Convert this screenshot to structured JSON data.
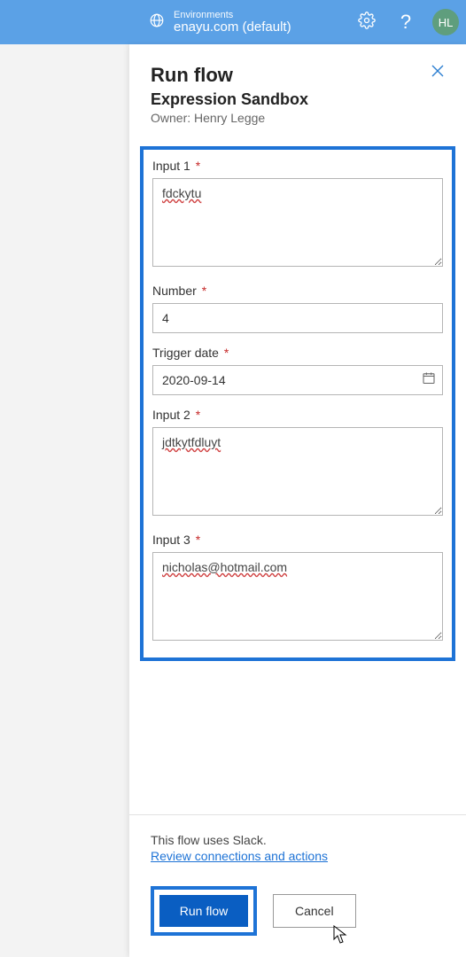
{
  "topbar": {
    "env_label": "Environments",
    "env_name": "enayu.com (default)",
    "avatar_initials": "HL"
  },
  "panel": {
    "title": "Run flow",
    "flow_name": "Expression Sandbox",
    "owner_line": "Owner: Henry Legge"
  },
  "fields": {
    "input1": {
      "label": "Input 1",
      "required": "*",
      "value": "fdckytu"
    },
    "number": {
      "label": "Number",
      "required": "*",
      "value": "4"
    },
    "trigger_date": {
      "label": "Trigger date",
      "required": "*",
      "value": "2020-09-14"
    },
    "input2": {
      "label": "Input 2",
      "required": "*",
      "value": "jdtkytfdluyt"
    },
    "input3": {
      "label": "Input 3",
      "required": "*",
      "value": "nicholas@hotmail.com"
    }
  },
  "footer": {
    "uses_text": "This flow uses Slack.",
    "review_link": "Review connections and actions",
    "run_label": "Run flow",
    "cancel_label": "Cancel"
  }
}
